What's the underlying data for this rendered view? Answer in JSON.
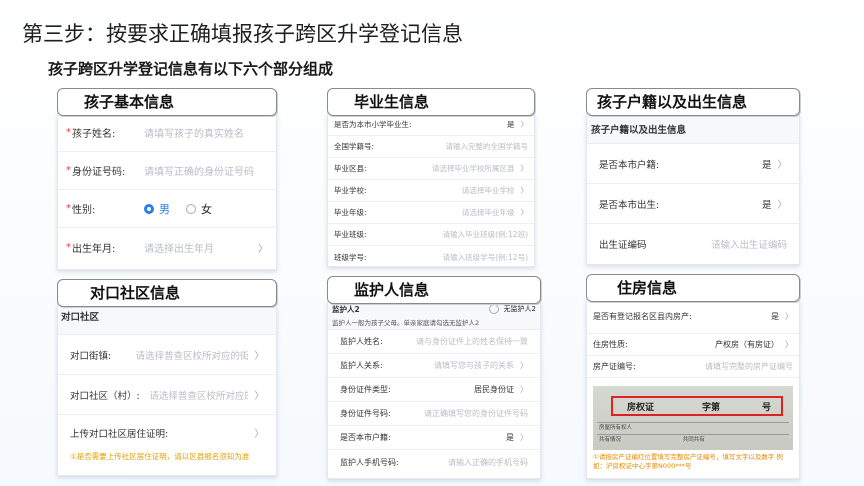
{
  "title": "第三步：按要求正确填报孩子跨区升学登记信息",
  "subtitle": "孩子跨区升学登记信息有以下六个部分组成",
  "sections": {
    "basic": {
      "header": "孩子基本信息",
      "rows": [
        {
          "label": "孩子姓名:",
          "placeholder": "请填写孩子的真实姓名"
        },
        {
          "label": "身份证号码:",
          "placeholder": "请填写正确的身份证号码"
        },
        {
          "label": "性别:",
          "male": "男",
          "female": "女"
        },
        {
          "label": "出生年月:",
          "placeholder": "请选择出生年月",
          "chev": "〉"
        }
      ]
    },
    "grad": {
      "header": "毕业生信息",
      "rows": [
        {
          "label": "是否为本市小学毕业生:",
          "value": "是",
          "chev": "〉"
        },
        {
          "label": "全国学籍号:",
          "placeholder": "请输入完整的全国学籍号"
        },
        {
          "label": "毕业区县:",
          "placeholder": "请选择毕业学校所属区县",
          "chev": "〉"
        },
        {
          "label": "毕业学校:",
          "placeholder": "请选择毕业学校",
          "chev": "〉"
        },
        {
          "label": "毕业年级:",
          "placeholder": "请选择毕业年级",
          "chev": "〉"
        },
        {
          "label": "毕业班级:",
          "placeholder": "请输入毕业班级(例:12班)"
        },
        {
          "label": "班级学号:",
          "placeholder": "请输入班级学号(例:12号)"
        }
      ]
    },
    "hukou": {
      "header": "孩子户籍以及出生信息",
      "section_title": "孩子户籍以及出生信息",
      "rows": [
        {
          "label": "是否本市户籍:",
          "value": "是",
          "chev": "〉"
        },
        {
          "label": "是否本市出生:",
          "value": "是",
          "chev": "〉"
        },
        {
          "label": "出生证编码",
          "placeholder": "请输入出生证编码"
        }
      ]
    },
    "community": {
      "header": "对口社区信息",
      "section_title": "对口社区",
      "rows": [
        {
          "label": "对口街镇:",
          "placeholder": "请选择普查区校所对应的街镇",
          "chev": "〉"
        },
        {
          "label": "对口社区（村）:",
          "placeholder": "请选择普查区校所对应的社",
          "chev": "〉"
        },
        {
          "label": "上传对口社区居住证明:",
          "chev": "〉"
        }
      ],
      "note": "①是否需要上传社区居住证明，请以区县报名须知为准"
    },
    "guardian": {
      "header": "监护人信息",
      "section_title": "监护人2",
      "no_guardian": "无监护人2",
      "hint": "监护人一般为孩子父母。单亲家庭请勾选无监护人2",
      "rows": [
        {
          "label": "监护人姓名:",
          "placeholder": "请与身份证件上的姓名保持一致"
        },
        {
          "label": "监护人关系:",
          "placeholder": "请填写您与孩子的关系",
          "chev": "〉"
        },
        {
          "label": "身份证件类型:",
          "value": "居民身份证",
          "chev": "〉"
        },
        {
          "label": "身份证件号码:",
          "placeholder": "请正确填写您的身份证件号码"
        },
        {
          "label": "是否本市户籍:",
          "value": "是",
          "chev": "〉"
        },
        {
          "label": "监护人手机号码:",
          "placeholder": "请输入正确的手机号码"
        }
      ]
    },
    "housing": {
      "header": "住房信息",
      "rows": [
        {
          "label": "是否有登记报名区县内房产:",
          "value": "是",
          "chev": "〉"
        },
        {
          "label": "住房性质:",
          "value": "产权房（有房证）",
          "chev": "〉"
        },
        {
          "label": "房产证编号:",
          "placeholder": "请填写完整的房产证编号"
        }
      ],
      "cert_title": "房权证",
      "cert_word": "字第",
      "cert_num": "号",
      "cert_row1": "房屋所有权人",
      "cert_row2": "共有情况",
      "cert_row2_val": "共同共有",
      "note": "①请按房产证编红位置填写完整房产证编号，填写文字以及数字 例如：沪房权证中心字第N000***号"
    }
  }
}
